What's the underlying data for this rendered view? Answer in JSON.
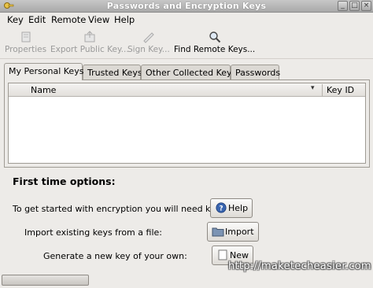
{
  "window": {
    "title": "Passwords and Encryption Keys"
  },
  "menubar": {
    "items": [
      "Key",
      "Edit",
      "Remote",
      "View",
      "Help"
    ]
  },
  "toolbar": {
    "properties": "Properties",
    "export_public_key": "Export Public Key...",
    "sign_key": "Sign Key...",
    "find_remote_keys": "Find Remote Keys..."
  },
  "tabs": [
    "My Personal Keys",
    "Trusted Keys",
    "Other Collected Keys",
    "Passwords"
  ],
  "keys_list": {
    "columns": [
      "Name",
      "Key ID"
    ],
    "rows": []
  },
  "first_time": {
    "title": "First time options:",
    "line_help": "To get started with encryption you will need keys.",
    "btn_help": "Help",
    "line_import": "Import existing keys from a file:",
    "btn_import": "Import",
    "line_new": "Generate a new key of your own:",
    "btn_new": "New"
  },
  "watermark": "http://maketecheasier.com"
}
